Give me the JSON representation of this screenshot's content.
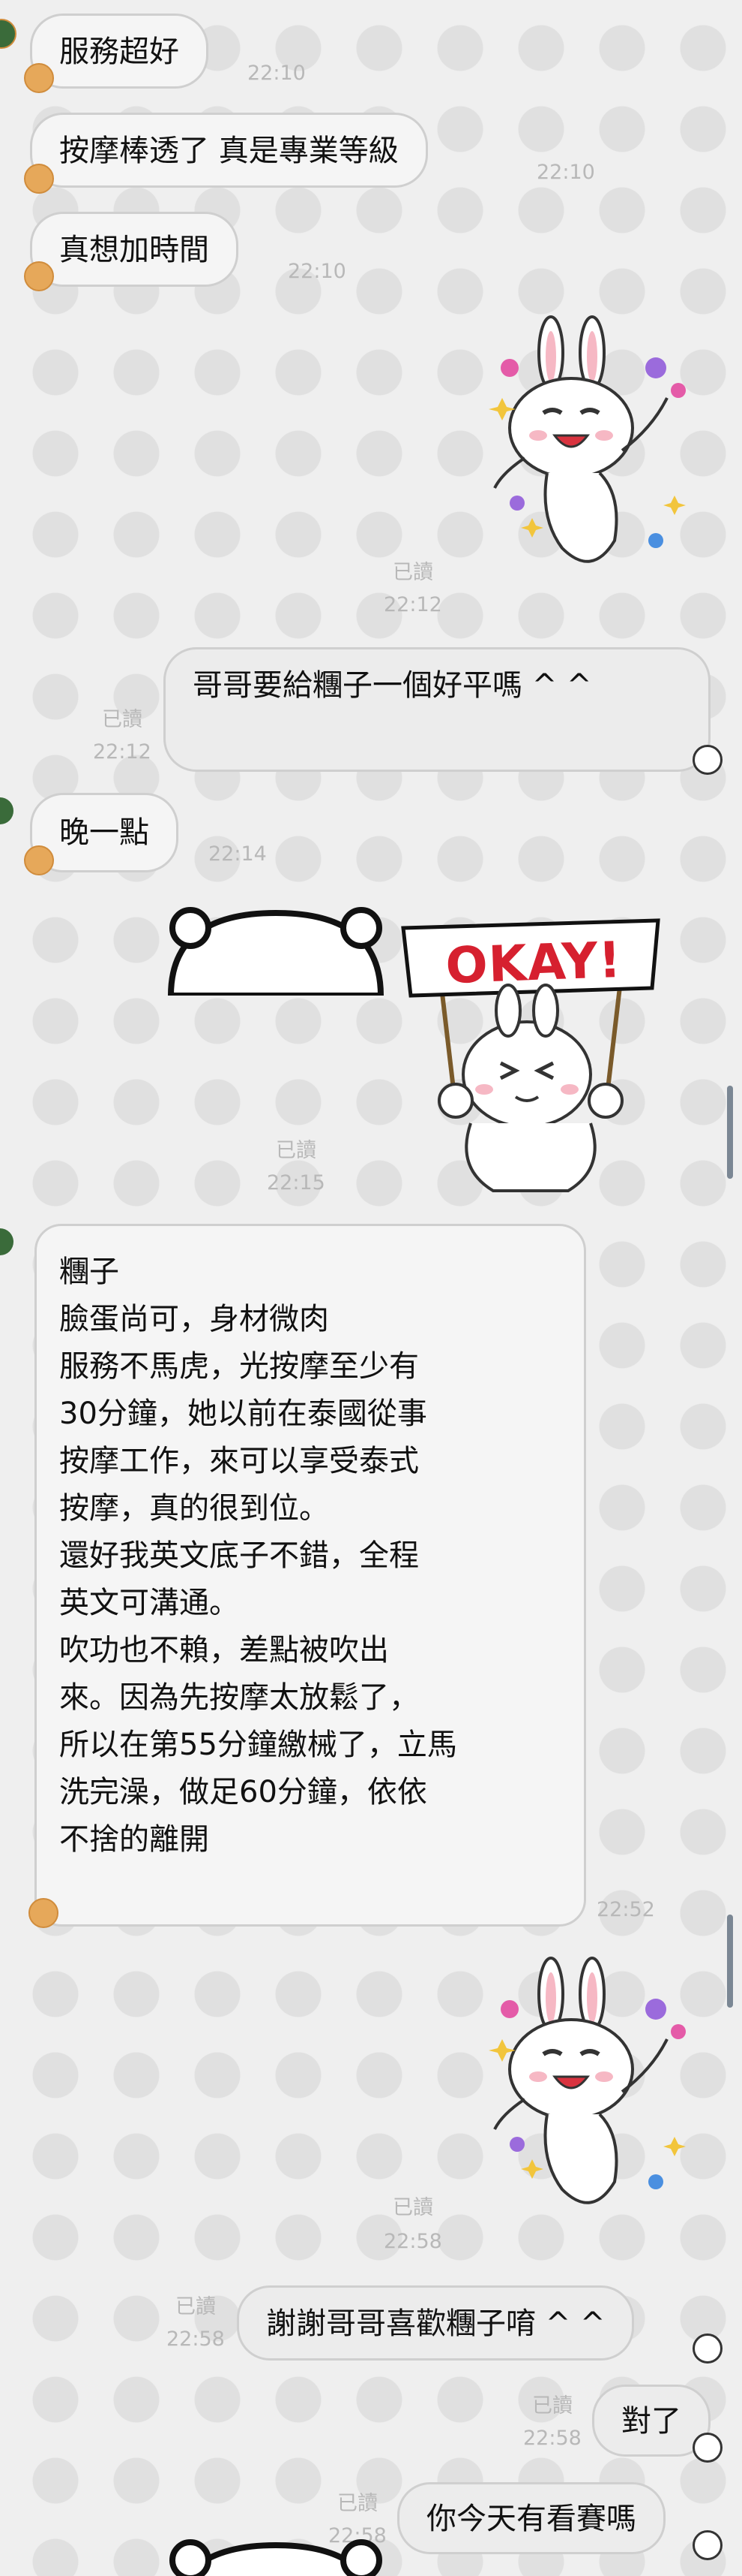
{
  "messages": {
    "m1": {
      "text": "服務超好",
      "time": "22:10"
    },
    "m2": {
      "text": "按摩棒透了 真是專業等級",
      "time": "22:10"
    },
    "m3": {
      "text": "真想加時間",
      "time": "22:10"
    },
    "s1": {
      "read": "已讀",
      "time": "22:12"
    },
    "m4": {
      "text": "哥哥要給糰子一個好平嗎 ^ ^",
      "read": "已讀",
      "time": "22:12"
    },
    "m5": {
      "text": "晚一點",
      "time": "22:14"
    },
    "s2": {
      "sign_text": "OKAY!",
      "read": "已讀",
      "time": "22:15"
    },
    "m6": {
      "lines": [
        "糰子",
        "臉蛋尚可，身材微肉",
        "服務不馬虎，光按摩至少有",
        "30分鐘，她以前在泰國從事",
        "按摩工作，來可以享受泰式",
        "按摩，真的很到位。",
        "還好我英文底子不錯，全程",
        "英文可溝通。",
        "吹功也不賴，差點被吹出",
        "來。因為先按摩太放鬆了，",
        "所以在第55分鐘繳械了，立馬",
        "洗完澡，做足60分鐘，依依",
        "不捨的離開"
      ],
      "time": "22:52"
    },
    "s3": {
      "read": "已讀",
      "time": "22:58"
    },
    "m7": {
      "text": "謝謝哥哥喜歡糰子唷 ^ ^",
      "read": "已讀",
      "time": "22:58"
    },
    "m8": {
      "text": "對了",
      "read": "已讀",
      "time": "22:58"
    },
    "m9": {
      "text": "你今天有看賽嗎",
      "read": "已讀",
      "time": "22:58"
    }
  }
}
